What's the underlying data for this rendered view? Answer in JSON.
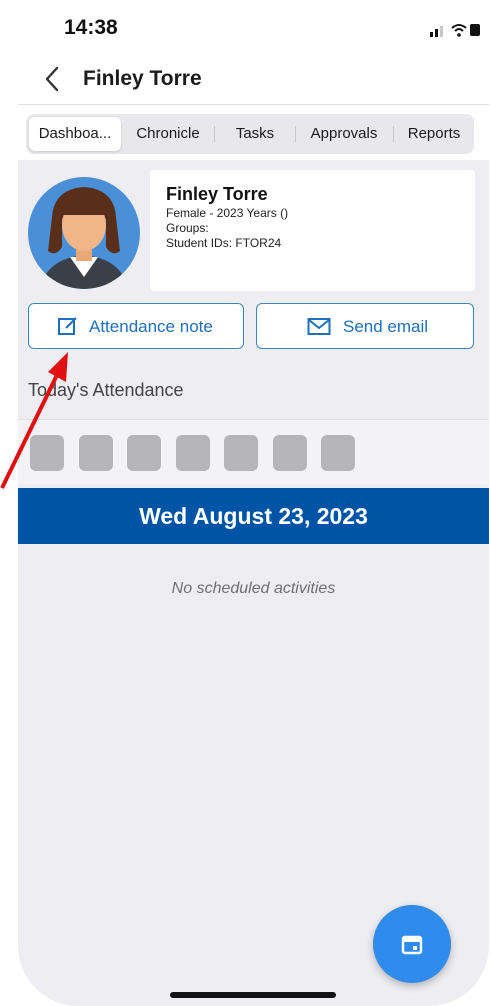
{
  "status_bar": {
    "time": "14:38"
  },
  "nav": {
    "title": "Finley Torre"
  },
  "tabs": [
    {
      "label": "Dashboa..."
    },
    {
      "label": "Chronicle"
    },
    {
      "label": "Tasks"
    },
    {
      "label": "Approvals"
    },
    {
      "label": "Reports"
    }
  ],
  "profile": {
    "name": "Finley Torre",
    "gender_age": "Female - 2023 Years ()",
    "groups": "Groups:",
    "student_ids": "Student IDs: FTOR24"
  },
  "actions": {
    "attendance_note": "Attendance note",
    "send_email": "Send email"
  },
  "attendance": {
    "title": "Today's Attendance",
    "boxes": 7
  },
  "schedule": {
    "date": "Wed August 23, 2023",
    "empty_message": "No scheduled activities"
  },
  "colors": {
    "accent": "#1f6fba",
    "date_banner": "#0054a6",
    "fab": "#2f8cec",
    "annotation_arrow": "#e11010"
  },
  "icons": [
    "back-chevron-icon",
    "signal-icon",
    "wifi-icon",
    "battery-icon",
    "edit-note-icon",
    "mail-icon",
    "calendar-icon"
  ]
}
